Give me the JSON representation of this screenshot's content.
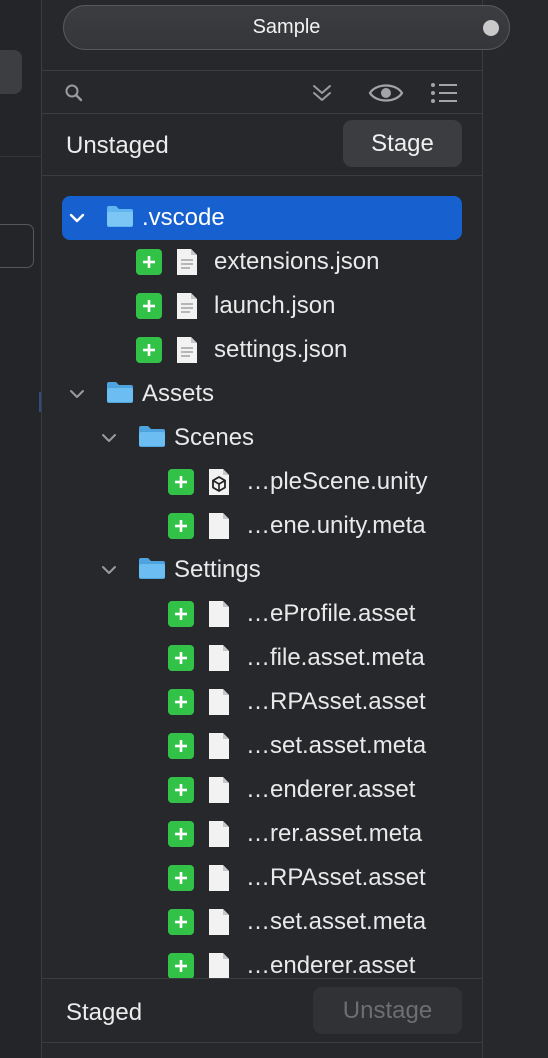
{
  "header": {
    "branch_label": "Sample"
  },
  "toolbar": {
    "icons": [
      "search-icon",
      "collapse-all-icon",
      "eye-icon",
      "list-icon"
    ]
  },
  "unstaged": {
    "title": "Unstaged",
    "button": "Stage"
  },
  "staged": {
    "title": "Staged",
    "button": "Unstage"
  },
  "tree": {
    "vscode": ".vscode",
    "extensions": "extensions.json",
    "launch": "launch.json",
    "settings": "settings.json",
    "assets": "Assets",
    "scenes": "Scenes",
    "scene_unity": "…pleScene.unity",
    "scene_meta": "…ene.unity.meta",
    "settings_folder": "Settings",
    "f1": "…eProfile.asset",
    "f2": "…file.asset.meta",
    "f3": "…RPAsset.asset",
    "f4": "…set.asset.meta",
    "f5": "…enderer.asset",
    "f6": "…rer.asset.meta",
    "f7": "…RPAsset.asset",
    "f8": "…set.asset.meta",
    "f9": "…enderer.asset"
  },
  "colors": {
    "selection": "#1660cf",
    "added": "#33c248",
    "folder": "#62b6ef"
  }
}
